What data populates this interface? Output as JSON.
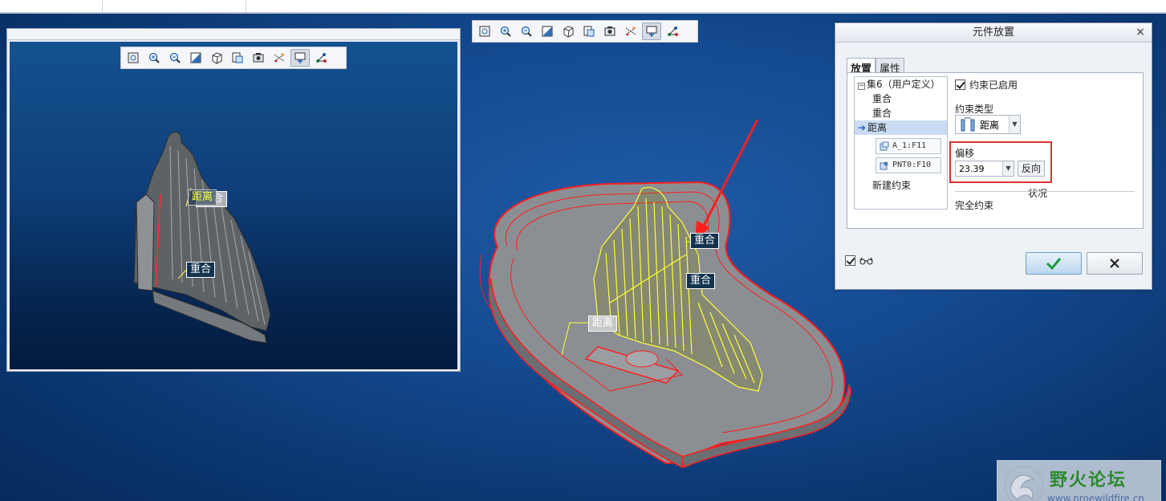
{
  "preview": {
    "toolbar_icons": [
      "refit-icon",
      "zoom-in-icon",
      "zoom-out-icon",
      "shading-icon",
      "orientation-icon",
      "saved-views-icon",
      "display-style-icon",
      "datum-display-icon",
      "spin-center-icon",
      "annotation-icon"
    ],
    "annotations": {
      "distance_label": "距离",
      "distance_tag_fragment": "合",
      "coincident_label": "重合"
    }
  },
  "main": {
    "toolbar_icons": [
      "refit-icon",
      "zoom-in-icon",
      "zoom-out-icon",
      "shading-icon",
      "orientation-icon",
      "saved-views-icon",
      "display-style-icon",
      "datum-display-icon",
      "spin-center-icon",
      "annotation-icon"
    ],
    "annotations": {
      "coincident_label_1": "重合",
      "coincident_label_2": "重合",
      "distance_label": "距离"
    }
  },
  "dialog": {
    "title": "元件放置",
    "close": "×",
    "tabs": [
      "放置",
      "属性"
    ],
    "tree": {
      "set_label": "集6（用户定义）",
      "items": [
        "重合",
        "重合",
        "距离"
      ],
      "refs": [
        "A_1:F11",
        "PNT0:F10"
      ],
      "new_constraint": "新建约束"
    },
    "constraint_enabled": "约束已启用",
    "constraint_type_label": "约束类型",
    "constraint_type_value": "距离",
    "offset_label": "偏移",
    "offset_value": "23.39",
    "flip_button": "反向",
    "status_label": "状况",
    "status_value": "完全约束"
  },
  "watermark": {
    "title": "野火论坛",
    "url": "www.proewildfire.cn"
  },
  "colors": {
    "viewport_bg": "#0d3f7e",
    "part_red": "#ff1e1e",
    "part_yellow": "#ffff33",
    "accent_red": "#e03030"
  }
}
